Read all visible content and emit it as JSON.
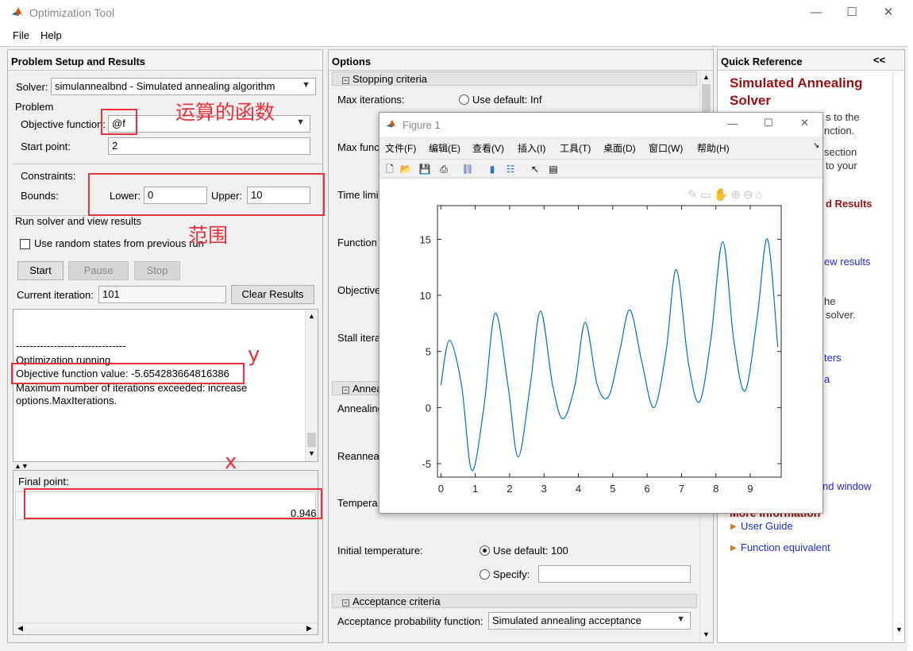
{
  "window": {
    "title": "Optimization Tool"
  },
  "menu": [
    "File",
    "Help"
  ],
  "setup": {
    "header": "Problem Setup and Results",
    "solver_label": "Solver:",
    "solver_value": "simulannealbnd - Simulated annealing algorithm",
    "problem_label": "Problem",
    "objective_label": "Objective function:",
    "objective_value": "@f",
    "start_label": "Start point:",
    "start_value": "2",
    "constraints_label": "Constraints:",
    "bounds_label": "Bounds:",
    "lower_label": "Lower:",
    "lower_value": "0",
    "upper_label": "Upper:",
    "upper_value": "10",
    "run_label": "Run solver and view results",
    "random_states_label": "Use random states from previous run",
    "start_btn": "Start",
    "pause_btn": "Pause",
    "stop_btn": "Stop",
    "current_iter_label": "Current iteration:",
    "current_iter_value": "101",
    "clear_btn": "Clear Results",
    "output": {
      "line1": "--------------------------------",
      "line2": "Optimization running.",
      "line3": "Objective function value: -5.654283664816386",
      "line4": "Maximum number of iterations exceeded: increase",
      "line5": "options.MaxIterations."
    },
    "final_point_label": "Final point:",
    "final_point_value": "0.946"
  },
  "options": {
    "header": "Options",
    "stopping_section": "Stopping criteria",
    "max_iter_label": "Max iterations:",
    "max_iter_default": "Use default: Inf",
    "max_fun_label": "Max func",
    "time_limit_label": "Time limi",
    "function_label": "Function",
    "objective_label": "Objective",
    "stall_label": "Stall itera",
    "annealing_section": "Annea",
    "annealing_label": "Annealing",
    "reanneal_label": "Reanneal",
    "temperature_label": "Tempera",
    "initial_temp_label": "Initial temperature:",
    "initial_temp_default": "Use default: 100",
    "specify_label": "Specify:",
    "acceptance_section": "Acceptance criteria",
    "acceptance_label": "Acceptance probability function:",
    "acceptance_value": "Simulated annealing acceptance"
  },
  "quickref": {
    "header": "Quick Reference",
    "collapse": "<<",
    "title_line1": "Simulated Annealing",
    "title_line2": "Solver",
    "t1": "s to the",
    "t2": "nction.",
    "t3": "section",
    "t4": "to your",
    "l1": "d Results",
    "l2": "ew results",
    "t5": "he",
    "t6": "solver.",
    "l3": "ters",
    "l4": "a",
    "l5": "nd window",
    "more_info": "More Information",
    "user_guide": "User Guide",
    "function_equiv": "Function equivalent"
  },
  "figure": {
    "title": "Figure 1",
    "menu": [
      "文件(F)",
      "编辑(E)",
      "查看(V)",
      "插入(I)",
      "工具(T)",
      "桌面(D)",
      "窗口(W)",
      "帮助(H)"
    ]
  },
  "annotations": {
    "func": "运算的函数",
    "range": "范围",
    "y": "y",
    "x": "x"
  },
  "chart_data": {
    "type": "line",
    "title": "",
    "xlabel": "",
    "ylabel": "",
    "xlim": [
      -0.1,
      9.9
    ],
    "ylim": [
      -6.2,
      18
    ],
    "xticks": [
      0,
      1,
      2,
      3,
      4,
      5,
      6,
      7,
      8,
      9
    ],
    "yticks": [
      -5,
      0,
      5,
      10,
      15
    ],
    "x": [
      0,
      0.25,
      0.6,
      0.9,
      1.25,
      1.58,
      1.95,
      2.25,
      2.6,
      2.9,
      3.25,
      3.55,
      3.9,
      4.2,
      4.55,
      4.88,
      5.2,
      5.5,
      5.85,
      6.2,
      6.55,
      6.85,
      7.2,
      7.52,
      7.85,
      8.2,
      8.52,
      8.85,
      9.2,
      9.5,
      9.8
    ],
    "y": [
      2,
      6,
      2,
      -5.6,
      0,
      8.4,
      2,
      -4.4,
      2,
      8.6,
      2,
      -1,
      2,
      7.6,
      2,
      1,
      5,
      8.7,
      4,
      0,
      5,
      12.3,
      4,
      0.5,
      6,
      14.8,
      6,
      1.5,
      8,
      15,
      5.4
    ],
    "color": "#0072bd"
  }
}
